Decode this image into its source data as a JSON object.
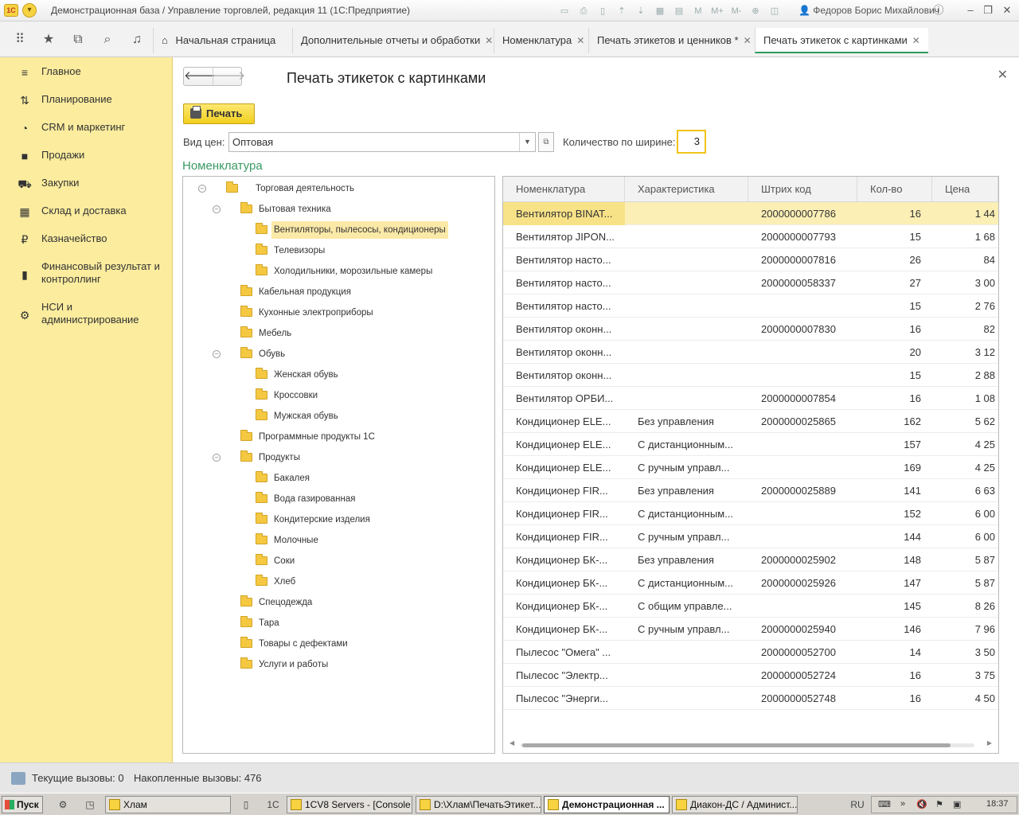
{
  "titlebar": {
    "logo": "1С",
    "title": "Демонстрационная база / Управление торговлей, редакция 11  (1С:Предприятие)",
    "tools": [
      "M",
      "M+",
      "M-"
    ],
    "user": "Федоров Борис Михайлович"
  },
  "tabs": [
    {
      "label": "Начальная страница",
      "closable": false,
      "active": false
    },
    {
      "label": "Дополнительные отчеты и обработки",
      "closable": true,
      "active": false
    },
    {
      "label": "Номенклатура",
      "closable": true,
      "active": false
    },
    {
      "label": "Печать этикетов и ценников *",
      "closable": true,
      "active": false
    },
    {
      "label": "Печать этикеток с картинками",
      "closable": true,
      "active": true
    }
  ],
  "sidebar": {
    "items": [
      {
        "label": "Главное",
        "icon": "menu-icon"
      },
      {
        "label": "Планирование",
        "icon": "planning-icon"
      },
      {
        "label": "CRM и маркетинг",
        "icon": "crm-icon"
      },
      {
        "label": "Продажи",
        "icon": "bag-icon"
      },
      {
        "label": "Закупки",
        "icon": "cart-icon"
      },
      {
        "label": "Склад и доставка",
        "icon": "warehouse-icon"
      },
      {
        "label": "Казначейство",
        "icon": "ruble-icon"
      },
      {
        "label": "Финансовый результат и контроллинг",
        "icon": "chart-icon"
      },
      {
        "label": "НСИ и администрирование",
        "icon": "gear-icon"
      }
    ]
  },
  "form": {
    "title": "Печать этикеток с картинками",
    "print_label": "Печать",
    "price_type_label": "Вид цен:",
    "price_type_value": "Оптовая",
    "qty_label": "Количество по ширине:",
    "qty_value": "3",
    "section_title": "Номенклатура"
  },
  "tree": [
    {
      "label": "Торговая деятельность",
      "level": 0,
      "toggle": "⊖"
    },
    {
      "label": "Бытовая техника",
      "level": 1,
      "toggle": "⊖"
    },
    {
      "label": "Вентиляторы, пылесосы, кондиционеры",
      "level": 2,
      "toggle": "",
      "selected": true
    },
    {
      "label": "Телевизоры",
      "level": 2,
      "toggle": ""
    },
    {
      "label": "Холодильники, морозильные камеры",
      "level": 2,
      "toggle": ""
    },
    {
      "label": "Кабельная продукция",
      "level": 1,
      "toggle": ""
    },
    {
      "label": "Кухонные электроприборы",
      "level": 1,
      "toggle": ""
    },
    {
      "label": "Мебель",
      "level": 1,
      "toggle": ""
    },
    {
      "label": "Обувь",
      "level": 1,
      "toggle": "⊖"
    },
    {
      "label": "Женская обувь",
      "level": 2,
      "toggle": ""
    },
    {
      "label": "Кроссовки",
      "level": 2,
      "toggle": ""
    },
    {
      "label": "Мужская обувь",
      "level": 2,
      "toggle": ""
    },
    {
      "label": "Программные продукты 1С",
      "level": 1,
      "toggle": ""
    },
    {
      "label": "Продукты",
      "level": 1,
      "toggle": "⊖"
    },
    {
      "label": "Бакалея",
      "level": 2,
      "toggle": ""
    },
    {
      "label": "Вода газированная",
      "level": 2,
      "toggle": ""
    },
    {
      "label": "Кондитерские изделия",
      "level": 2,
      "toggle": ""
    },
    {
      "label": "Молочные",
      "level": 2,
      "toggle": ""
    },
    {
      "label": "Соки",
      "level": 2,
      "toggle": ""
    },
    {
      "label": "Хлеб",
      "level": 2,
      "toggle": ""
    },
    {
      "label": "Спецодежда",
      "level": 1,
      "toggle": ""
    },
    {
      "label": "Тара",
      "level": 1,
      "toggle": ""
    },
    {
      "label": "Товары с дефектами",
      "level": 1,
      "toggle": ""
    },
    {
      "label": "Услуги и работы",
      "level": 1,
      "toggle": ""
    }
  ],
  "grid": {
    "columns": [
      "Номенклатура",
      "Характеристика",
      "Штрих код",
      "Кол-во",
      "Цена"
    ],
    "rows": [
      [
        "Вентилятор BINAT...",
        "",
        "2000000007786",
        "16",
        "1 44"
      ],
      [
        "Вентилятор JIPON...",
        "",
        "2000000007793",
        "15",
        "1 68"
      ],
      [
        "Вентилятор насто...",
        "",
        "2000000007816",
        "26",
        "84"
      ],
      [
        "Вентилятор насто...",
        "",
        "2000000058337",
        "27",
        "3 00"
      ],
      [
        "Вентилятор насто...",
        "",
        "",
        "15",
        "2 76"
      ],
      [
        "Вентилятор оконн...",
        "",
        "2000000007830",
        "16",
        "82"
      ],
      [
        "Вентилятор оконн...",
        "",
        "",
        "20",
        "3 12"
      ],
      [
        "Вентилятор оконн...",
        "",
        "",
        "15",
        "2 88"
      ],
      [
        "Вентилятор ОРБИ...",
        "",
        "2000000007854",
        "16",
        "1 08"
      ],
      [
        "Кондиционер ELE...",
        "Без управления",
        "2000000025865",
        "162",
        "5 62"
      ],
      [
        "Кондиционер ELE...",
        "С дистанционным...",
        "",
        "157",
        "4 25"
      ],
      [
        "Кондиционер ELE...",
        "С ручным управл...",
        "",
        "169",
        "4 25"
      ],
      [
        "Кондиционер FIR...",
        "Без управления",
        "2000000025889",
        "141",
        "6 63"
      ],
      [
        "Кондиционер FIR...",
        "С дистанционным...",
        "",
        "152",
        "6 00"
      ],
      [
        "Кондиционер FIR...",
        "С ручным управл...",
        "",
        "144",
        "6 00"
      ],
      [
        "Кондиционер БК-...",
        "Без управления",
        "2000000025902",
        "148",
        "5 87"
      ],
      [
        "Кондиционер БК-...",
        "С дистанционным...",
        "2000000025926",
        "147",
        "5 87"
      ],
      [
        "Кондиционер БК-...",
        "С общим управле...",
        "",
        "145",
        "8 26"
      ],
      [
        "Кондиционер БК-...",
        "С ручным управл...",
        "2000000025940",
        "146",
        "7 96"
      ],
      [
        "Пылесос \"Омега\" ...",
        "",
        "2000000052700",
        "14",
        "3 50"
      ],
      [
        "Пылесос \"Электр...",
        "",
        "2000000052724",
        "16",
        "3 75"
      ],
      [
        "Пылесос \"Энерги...",
        "",
        "2000000052748",
        "16",
        "4 50"
      ]
    ]
  },
  "status": {
    "current_calls": "Текущие вызовы: 0",
    "accumulated_calls": "Накопленные вызовы: 476"
  },
  "taskbar": {
    "start": "Пуск",
    "items": [
      {
        "label": "Хлам",
        "active": false
      },
      {
        "label": "1CV8 Servers - [Console ...",
        "active": false
      },
      {
        "label": "D:\\Хлам\\ПечатьЭтикет...",
        "active": false
      },
      {
        "label": "Демонстрационная ...",
        "active": true
      },
      {
        "label": "Диакон-ДС / Админист...",
        "active": false
      }
    ],
    "lang": "RU",
    "time": "18:37"
  },
  "colors": {
    "sidebar_bg": "#fbec9e",
    "accent_green": "#3a9a63",
    "selection": "#fbefb5",
    "print_button": "#f2cf1f"
  }
}
